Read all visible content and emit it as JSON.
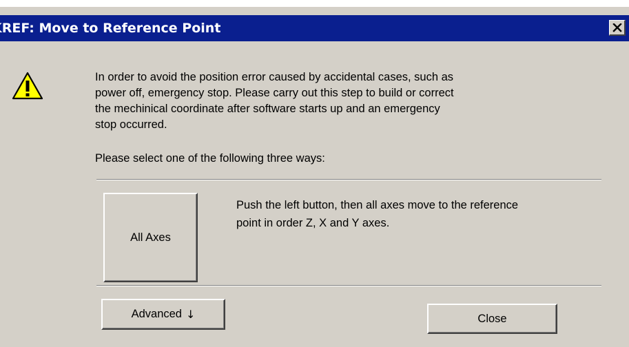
{
  "window": {
    "title": "KREF: Move to Reference Point",
    "close_symbol": "×"
  },
  "icons": {
    "warning": "warning-icon",
    "close": "close-icon",
    "arrow": "arrow-down-icon"
  },
  "colors": {
    "titlebar": "#0a1f8f",
    "dialog_bg": "#d4d0c8",
    "warning_fill": "#ffff00"
  },
  "message": {
    "lines": [
      "In order to avoid the position error caused by accidental cases, such as",
      "power off, emergency stop. Please carry out this step to build or correct",
      "the mechinical coordinate after software starts up and an emergency",
      "stop occurred."
    ],
    "prompt": "Please select one of the following three ways:"
  },
  "all_axes": {
    "button_label": "All Axes",
    "description_lines": [
      "Push the left button, then all axes move to the reference",
      "point in order Z, X and Y axes."
    ]
  },
  "footer": {
    "advanced_label": "Advanced",
    "advanced_arrow": "↓",
    "close_label": "Close"
  }
}
